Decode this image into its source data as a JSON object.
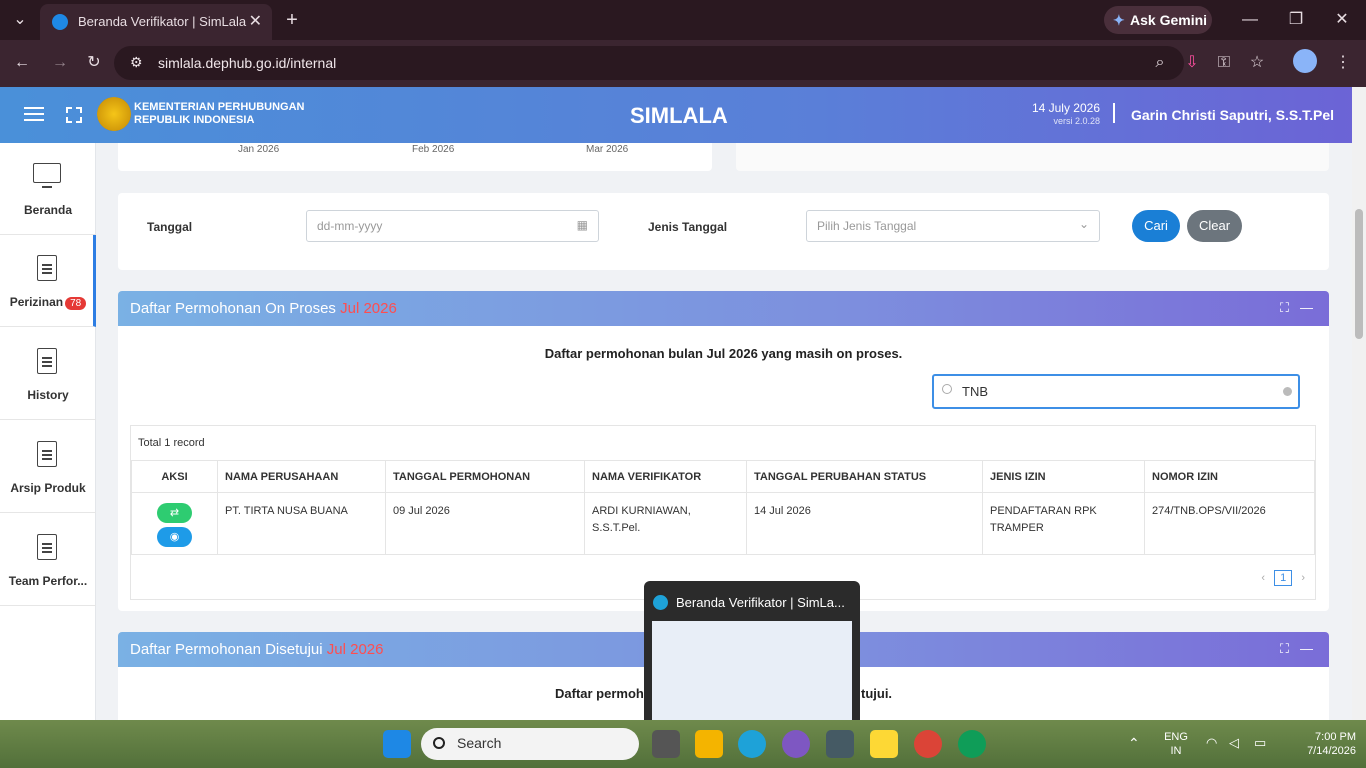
{
  "browser": {
    "tab_title": "Beranda Verifikator | SimLala",
    "url": "simlala.dephub.go.id/internal",
    "gemini_label": "Ask Gemini"
  },
  "header": {
    "org_line1": "KEMENTERIAN PERHUBUNGAN",
    "org_line2": "REPUBLIK INDONESIA",
    "app_name": "SIMLALA",
    "date": "14 July 2026",
    "version": "versi 2.0.28",
    "user": "Garin Christi Saputri, S.S.T.Pel"
  },
  "sidebar": {
    "items": [
      {
        "label": "Beranda"
      },
      {
        "label": "Perizinan",
        "badge": "78"
      },
      {
        "label": "History"
      },
      {
        "label": "Arsip Produk"
      },
      {
        "label": "Team Perfor..."
      }
    ]
  },
  "chart_strip": {
    "ticks": [
      "Jan 2026",
      "Feb 2026",
      "Mar 2026"
    ]
  },
  "filter": {
    "tanggal_label": "Tanggal",
    "tanggal_placeholder": "dd-mm-yyyy",
    "jenis_label": "Jenis Tanggal",
    "jenis_placeholder": "Pilih Jenis Tanggal",
    "cari_label": "Cari",
    "clear_label": "Clear"
  },
  "panel_proses": {
    "title": "Daftar Permohonan On Proses",
    "title_highlight": "Jul 2026",
    "description": "Daftar permohonan bulan Jul 2026 yang masih on proses.",
    "search_value": "TNB",
    "total": "Total 1 record",
    "columns": [
      "AKSI",
      "NAMA PERUSAHAAN",
      "TANGGAL PERMOHONAN",
      "NAMA VERIFIKATOR",
      "TANGGAL PERUBAHAN STATUS",
      "JENIS IZIN",
      "NOMOR IZIN"
    ],
    "rows": [
      {
        "perusahaan": "PT. TIRTA NUSA BUANA",
        "tgl_permohonan": "09 Jul 2026",
        "verifikator": "ARDI KURNIAWAN, S.S.T.Pel.",
        "tgl_status": "14 Jul 2026",
        "jenis_izin": "PENDAFTARAN RPK TRAMPER",
        "nomor_izin": "274/TNB.OPS/VII/2026"
      }
    ],
    "page": "1"
  },
  "panel_disetujui": {
    "title": "Daftar Permohonan Disetujui",
    "title_highlight": "Jul 2026",
    "description_left": "Daftar permoh",
    "description_right": "tujui."
  },
  "preview": {
    "title": "Beranda Verifikator | SimLa..."
  },
  "taskbar": {
    "search_label": "Search",
    "lang_line1": "ENG",
    "lang_line2": "IN",
    "time": "7:00 PM",
    "date": "7/14/2026"
  },
  "colors": {
    "header_start": "#4a90d9",
    "header_end": "#6c63d6",
    "accent_blue": "#2d7de3",
    "highlight_red": "#ff4d4f",
    "badge_red": "#e53935",
    "green_action": "#2ecc71"
  }
}
